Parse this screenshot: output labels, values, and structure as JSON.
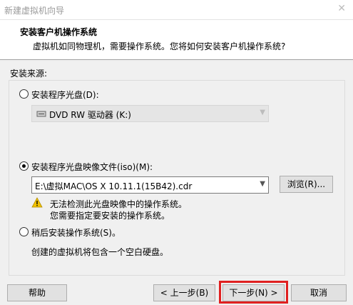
{
  "window": {
    "title": "新建虚拟机向导"
  },
  "header": {
    "title": "安装客户机操作系统",
    "description": "虚拟机如同物理机，需要操作系统。您将如何安装客户机操作系统?"
  },
  "source_label": "安装来源:",
  "options": {
    "disc": {
      "label": "安装程序光盘(D):",
      "selected": false,
      "drive": "DVD RW 驱动器 (K:)"
    },
    "iso": {
      "label": "安装程序光盘映像文件(iso)(M):",
      "selected": true,
      "path": "E:\\虚拟MAC\\OS X 10.11.1(15B42).cdr",
      "browse_label": "浏览(R)..."
    },
    "warning": {
      "line1": "无法检测此光盘映像中的操作系统。",
      "line2": "您需要指定要安装的操作系统。"
    },
    "later": {
      "label": "稍后安装操作系统(S)。",
      "selected": false,
      "description": "创建的虚拟机将包含一个空白硬盘。"
    }
  },
  "buttons": {
    "help": "帮助",
    "back": "< 上一步(B)",
    "next": "下一步(N) >",
    "cancel": "取消"
  },
  "colors": {
    "highlight": "#e02020",
    "warning": "#f2c200"
  }
}
